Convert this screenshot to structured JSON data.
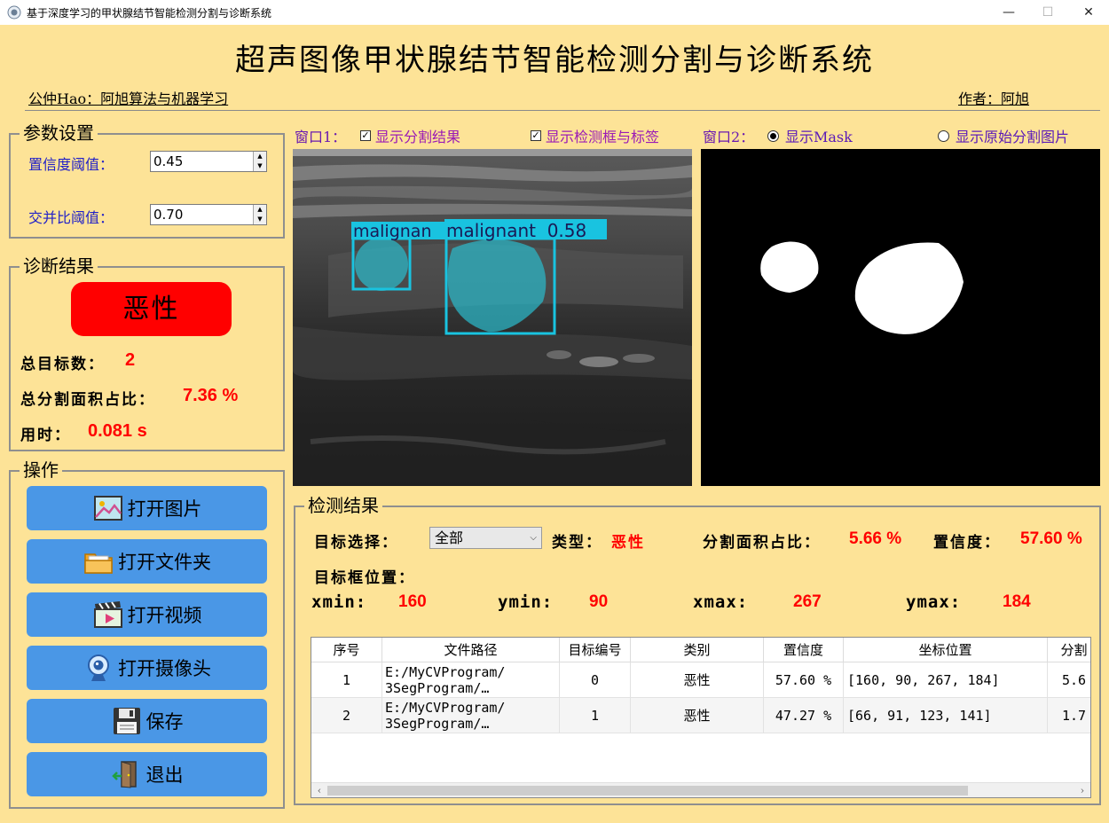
{
  "window": {
    "title": "基于深度学习的甲状腺结节智能检测分割与诊断系统",
    "minimize": "—",
    "maximize": "☐",
    "close": "✕"
  },
  "header": {
    "title": "超声图像甲状腺结节智能检测分割与诊断系统",
    "public_account": "公仲Hao：阿旭算法与机器学习",
    "author": "作者：阿旭"
  },
  "params": {
    "title": "参数设置",
    "confidence_label": "置信度阈值：",
    "confidence_value": "0.45",
    "iou_label": "交并比阈值：",
    "iou_value": "0.70"
  },
  "diagnosis": {
    "title": "诊断结果",
    "result": "恶性",
    "total_targets_label": "总目标数：",
    "total_targets_value": "2",
    "area_ratio_label": "总分割面积占比：",
    "area_ratio_value": "7.36 %",
    "time_label": "用时：",
    "time_value": "0.081 s"
  },
  "operations": {
    "title": "操作",
    "open_image": "打开图片",
    "open_folder": "打开文件夹",
    "open_video": "打开视频",
    "open_camera": "打开摄像头",
    "save": "保存",
    "exit": "退出"
  },
  "viewer": {
    "window1_label": "窗口1：",
    "show_seg": "显示分割结果",
    "show_seg_checked": true,
    "show_box": "显示检测框与标签",
    "show_box_checked": true,
    "window2_label": "窗口2：",
    "show_mask": "显示Mask",
    "show_original": "显示原始分割图片",
    "box_label_1": "malignan",
    "box_label_2": "malignant  0.58"
  },
  "detection": {
    "title": "检测结果",
    "target_select_label": "目标选择：",
    "target_select_value": "全部",
    "type_label": "类型：",
    "type_value": "恶性",
    "area_label": "分割面积占比：",
    "area_value": "5.66 %",
    "conf_label": "置信度：",
    "conf_value": "57.60 %",
    "box_position_label": "目标框位置：",
    "xmin_label": "xmin:",
    "xmin": "160",
    "ymin_label": "ymin:",
    "ymin": "90",
    "xmax_label": "xmax:",
    "xmax": "267",
    "ymax_label": "ymax:",
    "ymax": "184"
  },
  "table": {
    "columns": [
      "序号",
      "文件路径",
      "目标编号",
      "类别",
      "置信度",
      "坐标位置",
      "分割"
    ],
    "rows": [
      {
        "index": "1",
        "path_line1": "E:/MyCVProgram/",
        "path_line2": "3SegProgram/…",
        "target_id": "0",
        "class": "恶性",
        "confidence": "57.60 %",
        "coords": "[160, 90, 267, 184]",
        "seg": "5.6"
      },
      {
        "index": "2",
        "path_line1": "E:/MyCVProgram/",
        "path_line2": "3SegProgram/…",
        "target_id": "1",
        "class": "恶性",
        "confidence": "47.27 %",
        "coords": "[66, 91, 123, 141]",
        "seg": "1.7"
      }
    ]
  },
  "colors": {
    "background": "#fde397",
    "accent_button": "#4a97e6",
    "malignant_red": "#ff0000",
    "detection_box": "#19c3e0"
  }
}
